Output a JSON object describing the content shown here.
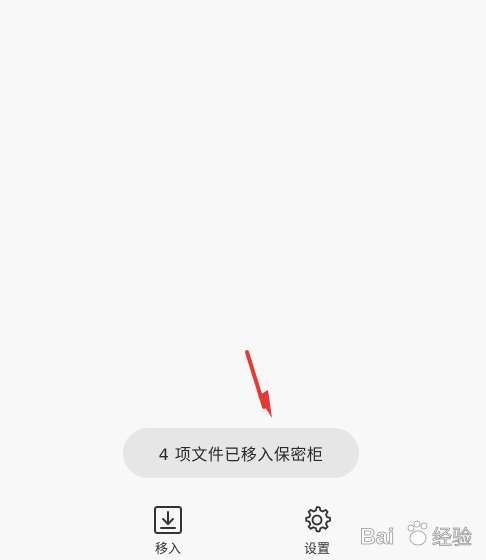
{
  "toast": {
    "message": "4 项文件已移入保密柜"
  },
  "bottom_bar": {
    "move_in_label": "移入",
    "settings_label": "设置"
  },
  "watermark": {
    "text": "Bai 经验",
    "icon": "baidu-paw-icon"
  },
  "icons": {
    "move_in": "download-tray-icon",
    "settings": "gear-icon",
    "annotation": "red-arrow-icon"
  },
  "colors": {
    "background": "#f8f8f8",
    "toast_bg": "#e6e6e6",
    "text": "#2a2a2a",
    "arrow": "#e53935"
  }
}
